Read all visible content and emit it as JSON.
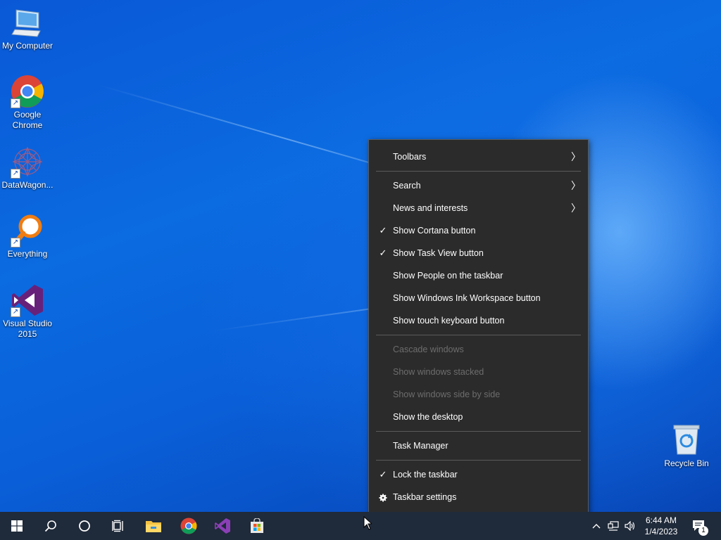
{
  "desktop": {
    "icons": [
      {
        "label": "My Computer",
        "icon": "computer-icon",
        "shortcut": false
      },
      {
        "label": "Google Chrome",
        "icon": "chrome-icon",
        "shortcut": true
      },
      {
        "label": "DataWagon...",
        "icon": "datawagon-icon",
        "shortcut": true
      },
      {
        "label": "Everything",
        "icon": "everything-search-icon",
        "shortcut": true
      },
      {
        "label": "Visual Studio 2015",
        "icon": "visual-studio-icon",
        "shortcut": true
      },
      {
        "label": "Recycle Bin",
        "icon": "recycle-bin-icon",
        "shortcut": false
      }
    ]
  },
  "context_menu": {
    "items": [
      {
        "label": "Toolbars",
        "submenu": true,
        "checked": false,
        "enabled": true
      },
      {
        "label": "Search",
        "submenu": true,
        "checked": false,
        "enabled": true
      },
      {
        "label": "News and interests",
        "submenu": true,
        "checked": false,
        "enabled": true
      },
      {
        "label": "Show Cortana button",
        "submenu": false,
        "checked": true,
        "enabled": true
      },
      {
        "label": "Show Task View button",
        "submenu": false,
        "checked": true,
        "enabled": true
      },
      {
        "label": "Show People on the taskbar",
        "submenu": false,
        "checked": false,
        "enabled": true
      },
      {
        "label": "Show Windows Ink Workspace button",
        "submenu": false,
        "checked": false,
        "enabled": true
      },
      {
        "label": "Show touch keyboard button",
        "submenu": false,
        "checked": false,
        "enabled": true
      },
      {
        "label": "Cascade windows",
        "submenu": false,
        "checked": false,
        "enabled": false
      },
      {
        "label": "Show windows stacked",
        "submenu": false,
        "checked": false,
        "enabled": false
      },
      {
        "label": "Show windows side by side",
        "submenu": false,
        "checked": false,
        "enabled": false
      },
      {
        "label": "Show the desktop",
        "submenu": false,
        "checked": false,
        "enabled": true
      },
      {
        "label": "Task Manager",
        "submenu": false,
        "checked": false,
        "enabled": true
      },
      {
        "label": "Lock the taskbar",
        "submenu": false,
        "checked": true,
        "enabled": true
      },
      {
        "label": "Taskbar settings",
        "submenu": false,
        "checked": false,
        "enabled": true,
        "icon": "gear-icon"
      }
    ],
    "check_glyph": "✓",
    "arrow_glyph": "〉"
  },
  "taskbar": {
    "buttons": [
      "start-icon",
      "search-icon",
      "cortana-icon",
      "task-view-icon",
      "file-explorer-icon",
      "chrome-icon",
      "visual-studio-icon",
      "store-icon"
    ],
    "tray": [
      "chevron-up-icon",
      "network-icon",
      "volume-icon"
    ],
    "time": "6:44 AM",
    "date": "1/4/2023",
    "notification_count": "1"
  },
  "colors": {
    "menu_bg": "#2b2b2b",
    "menu_text": "#ffffff",
    "menu_disabled": "#6d6d6d",
    "taskbar_bg": "#1f2a3a"
  }
}
